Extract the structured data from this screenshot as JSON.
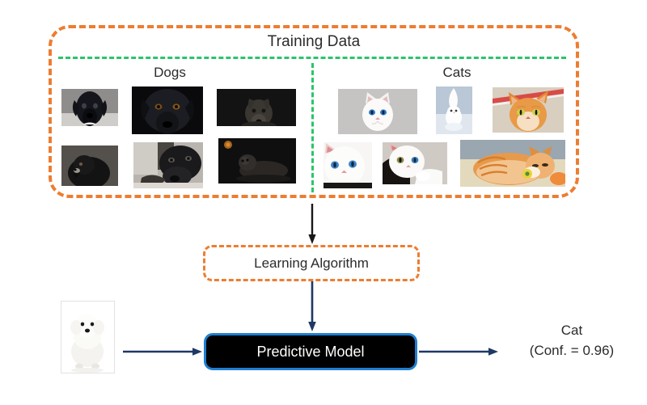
{
  "diagram": {
    "title": "Supervised learning pipeline",
    "training": {
      "container_label": "Training Data",
      "classes": [
        {
          "name": "Dogs",
          "count": 6,
          "samples": [
            "black-puppy-portrait",
            "black-labrador-face-closeup",
            "dark-puppy-ears-up",
            "black-dog-profile-gray-background",
            "black-labrador-lying-down",
            "black-dog-lying-dark-studio"
          ]
        },
        {
          "name": "Cats",
          "count": 6,
          "samples": [
            "white-cat-blue-eyes-front",
            "white-kitten-standing-snow",
            "orange-tabby-cat-face",
            "white-cat-blue-eyes-closeup",
            "white-kitten-lying-paw",
            "orange-tabby-cat-curled-sleeping"
          ]
        }
      ]
    },
    "stages": {
      "learning_algorithm": "Learning Algorithm",
      "predictive_model": "Predictive Model"
    },
    "query": {
      "image": "white-bichon-frise-dog-sitting"
    },
    "prediction": {
      "class_label": "Cat",
      "confidence_label": "(Conf. = 0.96)",
      "confidence_value": 0.96
    },
    "colors": {
      "container_border": "#ED7D31",
      "separator": "#2BC46A",
      "model_border": "#1F7FD0",
      "model_fill": "#000000",
      "arrow_dark": "#1F3864",
      "arrow_black": "#181818",
      "text": "#2b2b2b"
    },
    "arrows": [
      {
        "name": "training-to-algorithm",
        "color": "#181818"
      },
      {
        "name": "algorithm-to-model",
        "color": "#1F3864"
      },
      {
        "name": "query-to-model",
        "color": "#1F3864"
      },
      {
        "name": "model-to-prediction",
        "color": "#1F3864"
      }
    ]
  }
}
